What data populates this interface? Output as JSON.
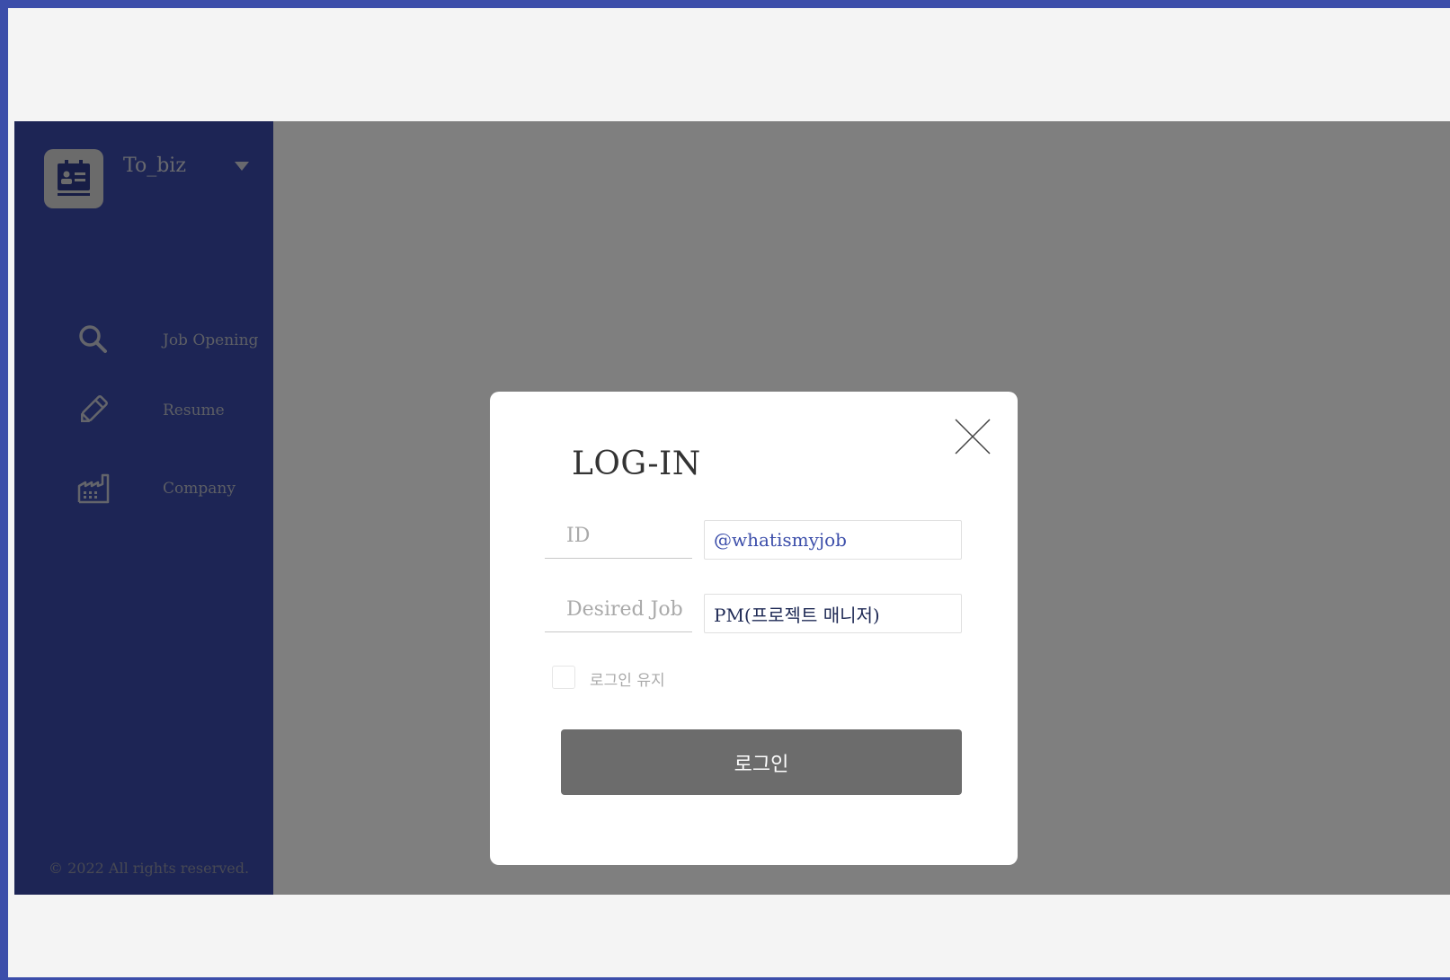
{
  "app": {
    "brand_name": "To_biz",
    "footer": "© 2022 All rights reserved."
  },
  "sidebar": {
    "items": [
      {
        "label": "Job Opening",
        "icon": "search-icon"
      },
      {
        "label": "Resume",
        "icon": "pencil-icon"
      },
      {
        "label": "Company",
        "icon": "factory-icon"
      }
    ]
  },
  "modal": {
    "title": "LOG-IN",
    "id_label": "ID",
    "id_value": "@whatismyjob",
    "job_label": "Desired Job",
    "job_value": "PM(프로젝트 매니저)",
    "keep_login_label": "로그인 유지",
    "login_button": "로그인"
  },
  "colors": {
    "frame": "#3c4eaa",
    "sidebar": "#3b4bab",
    "overlay": "rgba(0,0,0,0.5)",
    "id_text": "#3c4eaa",
    "job_text": "#1f2a55",
    "login_button": "#6c6c6c"
  }
}
